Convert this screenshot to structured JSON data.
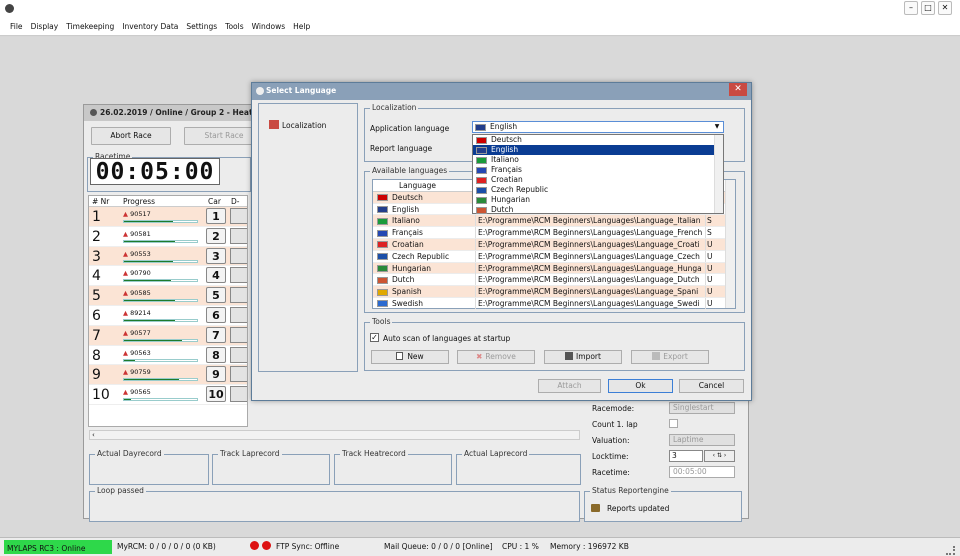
{
  "window": {
    "buttons": [
      "–",
      "□",
      "✕"
    ]
  },
  "menu": [
    "File",
    "Display",
    "Timekeeping",
    "Inventory Data",
    "Settings",
    "Tools",
    "Windows",
    "Help"
  ],
  "race": {
    "title": "26.02.2019 / Online / Group 2 - Heat 1",
    "abort_label": "Abort Race",
    "start_label": "Start Race",
    "racetime_label": "Racetime",
    "racetime": "00:05:00",
    "cols": [
      "# Nr",
      "Progress",
      "Car",
      "D-Nr"
    ],
    "rows": [
      {
        "nr": "1",
        "tr": "90517",
        "car": "1",
        "progress": 0.67
      },
      {
        "nr": "2",
        "tr": "90581",
        "car": "2",
        "progress": 0.7
      },
      {
        "nr": "3",
        "tr": "90553",
        "car": "3",
        "progress": 0.67
      },
      {
        "nr": "4",
        "tr": "90790",
        "car": "4",
        "progress": 0.65
      },
      {
        "nr": "5",
        "tr": "90585",
        "car": "5",
        "progress": 0.7
      },
      {
        "nr": "6",
        "tr": "89214",
        "car": "6",
        "progress": 0.7
      },
      {
        "nr": "7",
        "tr": "90577",
        "car": "7",
        "progress": 0.8
      },
      {
        "nr": "8",
        "tr": "90563",
        "car": "8",
        "progress": 0.15
      },
      {
        "nr": "9",
        "tr": "90759",
        "car": "9",
        "progress": 0.75
      },
      {
        "nr": "10",
        "tr": "90565",
        "car": "10",
        "progress": 0.1
      }
    ],
    "records": [
      "Actual Dayrecord",
      "Track Laprecord",
      "Track Heatrecord",
      "Actual Laprecord"
    ],
    "loop_label": "Loop passed",
    "settings": {
      "racemode_label": "Racemode:",
      "racemode": "Singlestart",
      "count_label": "Count 1. lap",
      "valuation_label": "Valuation:",
      "valuation": "Laptime",
      "locktime_label": "Locktime:",
      "locktime": "3",
      "racetime_label": "Racetime:",
      "racetime": "00:05:00"
    },
    "report": {
      "label": "Status Reportengine",
      "text": "Reports updated"
    }
  },
  "dialog": {
    "title": "Select Language",
    "close": "✕",
    "tree_item": "Localization",
    "loc_group": "Localization",
    "app_lang_label": "Application language",
    "app_lang": "English",
    "report_lang_label": "Report language",
    "dropdown": [
      "Deutsch",
      "English",
      "Italiano",
      "Français",
      "Croatian",
      "Czech Republic",
      "Hungarian",
      "Dutch"
    ],
    "available_label": "Available languages",
    "lang_col": "Language",
    "langs": [
      {
        "name": "Deutsch",
        "path": "",
        "c": "",
        "flag": "de"
      },
      {
        "name": "English",
        "path": "",
        "c": "",
        "flag": "gb"
      },
      {
        "name": "Italiano",
        "path": "E:\\Programme\\RCM Beginners\\Languages\\Language_Italian",
        "c": "S",
        "flag": "it"
      },
      {
        "name": "Français",
        "path": "E:\\Programme\\RCM Beginners\\Languages\\Language_French",
        "c": "S",
        "flag": "fr"
      },
      {
        "name": "Croatian",
        "path": "E:\\Programme\\RCM Beginners\\Languages\\Language_Croati",
        "c": "U",
        "flag": "hr"
      },
      {
        "name": "Czech Republic",
        "path": "E:\\Programme\\RCM Beginners\\Languages\\Language_Czech",
        "c": "U",
        "flag": "cz"
      },
      {
        "name": "Hungarian",
        "path": "E:\\Programme\\RCM Beginners\\Languages\\Language_Hunga",
        "c": "U",
        "flag": "hu"
      },
      {
        "name": "Dutch",
        "path": "E:\\Programme\\RCM Beginners\\Languages\\Language_Dutch",
        "c": "U",
        "flag": "nl"
      },
      {
        "name": "Spanish",
        "path": "E:\\Programme\\RCM Beginners\\Languages\\Language_Spani",
        "c": "U",
        "flag": "es"
      },
      {
        "name": "Swedish",
        "path": "E:\\Programme\\RCM Beginners\\Languages\\Language_Swedi",
        "c": "U",
        "flag": "se"
      }
    ],
    "tools_label": "Tools",
    "autoscan_label": "Auto scan of languages at startup",
    "btn_new": "New",
    "btn_remove": "Remove",
    "btn_import": "Import",
    "btn_export": "Export",
    "btn_attach": "Attach",
    "btn_ok": "Ok",
    "btn_cancel": "Cancel"
  },
  "status": {
    "mylaps": "MYLAPS RC3 : Online",
    "myrcm": "MyRCM: 0 / 0 / 0 / 0 (0 KB)",
    "ftp": "FTP Sync: Offline",
    "mail": "Mail Queue: 0 / 0 / 0 [Online]",
    "cpu": "CPU : 1 %",
    "memory": "Memory : 196972 KB"
  },
  "colors": {
    "accent": "#0a3c93",
    "highlight_row": "#fbe4d5",
    "online": "#2ed84a",
    "progress": "#1d7b2c"
  }
}
